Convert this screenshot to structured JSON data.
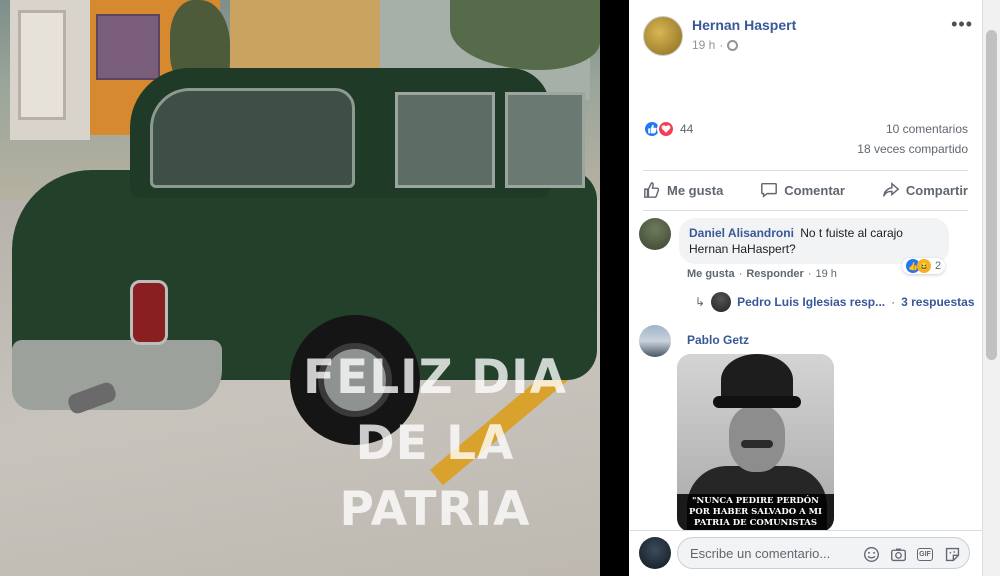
{
  "post": {
    "author": "Hernan Haspert",
    "time": "19 h",
    "image_caption": "FELIZ DIA DE LA PATRIA",
    "reaction_count": "44",
    "comments_count": "10 comentarios",
    "shares_count": "18 veces compartido"
  },
  "actions": {
    "like": "Me gusta",
    "comment": "Comentar",
    "share": "Compartir"
  },
  "comments": [
    {
      "author": "Daniel Alisandroni",
      "text": "No t fuiste al carajo Hernan HaHaspert?",
      "like_label": "Me gusta",
      "reply_label": "Responder",
      "time": "19 h",
      "reaction_count": "2",
      "replies_author": "Pedro Luis Iglesias resp...",
      "replies_count": "3 respuestas",
      "separator": "·"
    },
    {
      "author": "Pablo Getz",
      "image_quote": "\"NUNCA PEDIRE PERDÓN POR HABER SALVADO A MI PATRIA DE COMUNISTAS TERRORISTAS\""
    }
  ],
  "composer": {
    "placeholder": "Escribe un comentario..."
  },
  "colors": {
    "link": "#385898",
    "like_blue": "#2078f4",
    "love_red": "#f33e58",
    "car_green": "#23402a"
  }
}
